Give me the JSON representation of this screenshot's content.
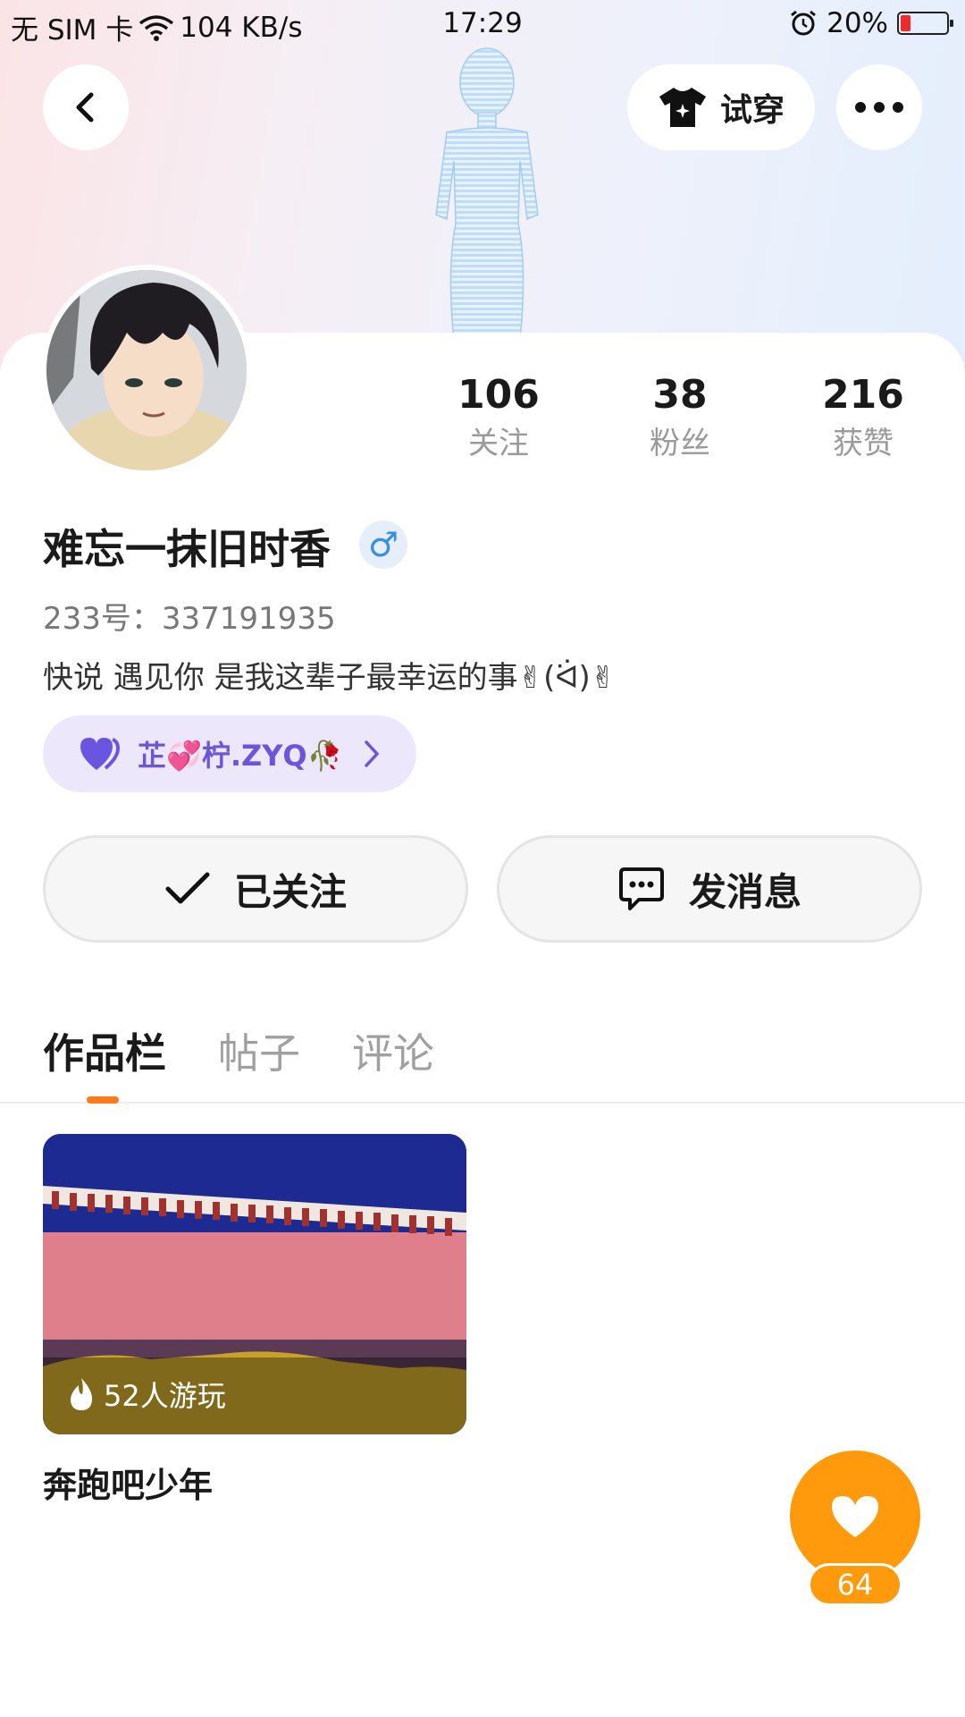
{
  "status_bar": {
    "carrier": "无 SIM 卡",
    "speed": "104 KB/s",
    "time": "17:29",
    "battery": "20%",
    "battery_level": 0.2
  },
  "header": {
    "back_icon": "chevron-left-icon",
    "tryon_label": "试穿",
    "tryon_icon": "tshirt-sparkle-icon",
    "more_icon": "more-dots-icon"
  },
  "profile": {
    "username": "难忘一抹旧时香",
    "gender": "♂",
    "gender_color": "#3a8ee6",
    "uid": "233号：337191935",
    "bio": "快说 遇见你 是我这辈子最幸运的事✌(ᐛ)✌",
    "stats": [
      {
        "value": "106",
        "label": "关注"
      },
      {
        "value": "38",
        "label": "粉丝"
      },
      {
        "value": "216",
        "label": "获赞"
      }
    ],
    "cp_tag": {
      "label": "芷💞柠.ZYQ🥀",
      "icon": "purple-heart-icon"
    }
  },
  "actions": {
    "follow_label": "已关注",
    "message_label": "发消息"
  },
  "tabs": [
    {
      "label": "作品栏",
      "active": true
    },
    {
      "label": "帖子",
      "active": false
    },
    {
      "label": "评论",
      "active": false
    }
  ],
  "works": [
    {
      "title": "奔跑吧少年",
      "players": "52人游玩"
    }
  ],
  "like": {
    "count": "64",
    "color": "#ff9a0d"
  },
  "accent_color": "#ff7a1a"
}
